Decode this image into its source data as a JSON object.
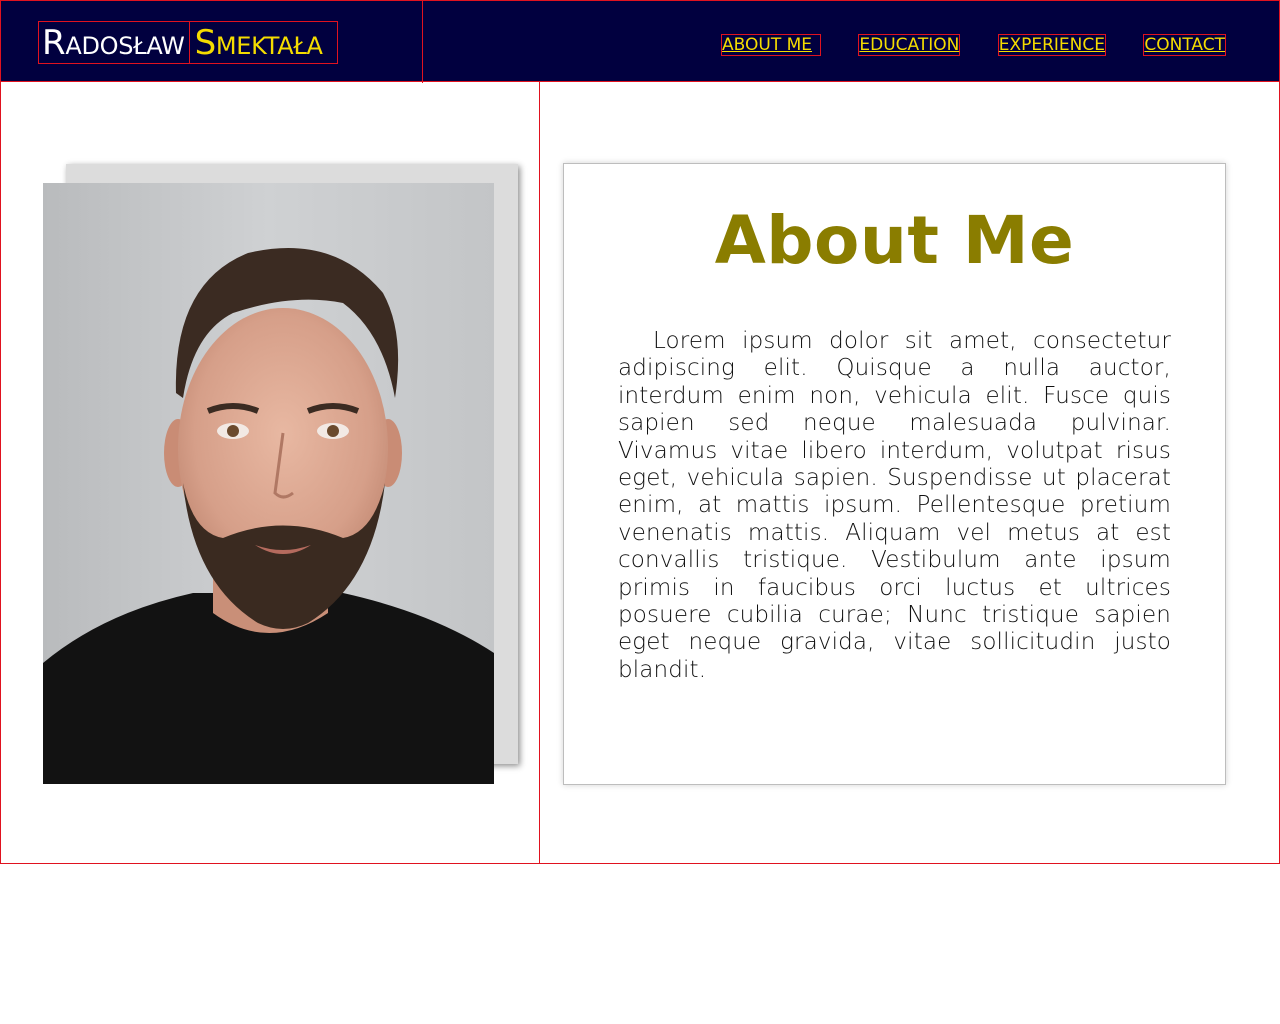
{
  "brand": {
    "first_name": "Radosław",
    "last_name": "Smektała"
  },
  "nav": {
    "items": [
      {
        "label": "ABOUT ME"
      },
      {
        "label": "EDUCATION"
      },
      {
        "label": "EXPERIENCE"
      },
      {
        "label": "CONTACT"
      }
    ]
  },
  "about": {
    "title": "About Me",
    "body": "Lorem ipsum dolor sit amet, consectetur adipiscing elit. Quisque a nulla auctor, interdum enim non, vehicula elit. Fusce quis sapien sed neque malesuada pulvinar. Vivamus vitae libero interdum, volutpat risus eget, vehicula sapien. Suspendisse ut placerat enim, at mattis ipsum. Pellentesque pretium venenatis mattis. Aliquam vel metus at est convallis tristique. Vestibulum ante ipsum primis in faucibus orci luctus et ultrices posuere cubilia curae; Nunc tristique sapien eget neque gravida, vitae sollicitudin justo blandit."
  },
  "colors": {
    "header_bg": "#01003f",
    "outline": "#e0121f",
    "accent_yellow": "#f5dc00",
    "title_olive": "#8a7d00"
  }
}
